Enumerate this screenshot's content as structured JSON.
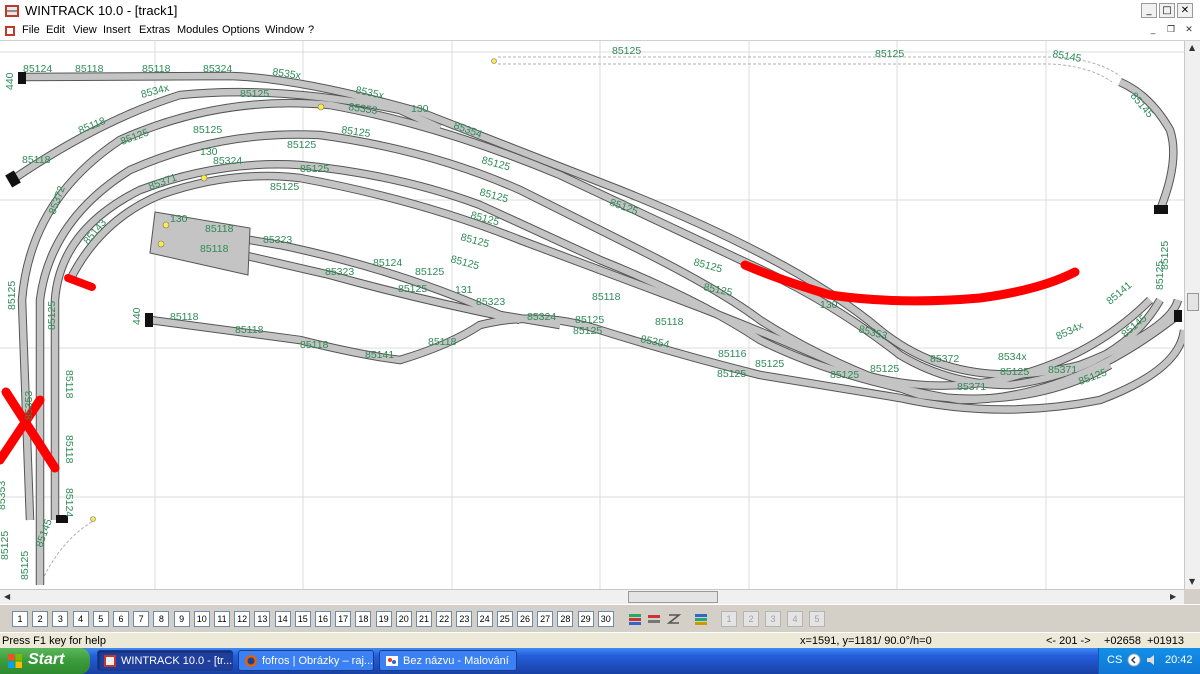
{
  "window": {
    "title": "WINTRACK 10.0 - [track1]"
  },
  "menu": [
    "File",
    "Edit",
    "View",
    "Insert",
    "Extras",
    "Modules",
    "Options",
    "Window",
    "?"
  ],
  "track_labels": [
    "85124",
    "85118",
    "85118",
    "85324",
    "8535x",
    "85125",
    "85145",
    "440",
    "8534x",
    "8535x",
    "85125",
    "85353",
    "130",
    "85354",
    "85145",
    "85118",
    "85125",
    "85125",
    "85125",
    "85125",
    "85118",
    "130",
    "85324",
    "85125",
    "85125",
    "85125",
    "85125",
    "85125",
    "85125",
    "85125",
    "85125",
    "85125",
    "85372",
    "85371",
    "85143",
    "85125",
    "85125",
    "440",
    "85118",
    "85118",
    "85118",
    "85141",
    "85118",
    "85323",
    "85323",
    "85124",
    "85125",
    "85125",
    "131",
    "85323",
    "85324",
    "85125",
    "85125",
    "85118",
    "85118",
    "85125",
    "85354",
    "85116",
    "85125",
    "85125",
    "85353",
    "85125",
    "85125",
    "85372",
    "8534x",
    "85371",
    "85371",
    "85141",
    "85145",
    "8534x",
    "85125",
    "85125",
    "85118",
    "85118",
    "85124",
    "85145",
    "85125",
    "85353",
    "85353",
    "85125",
    "130",
    "85125",
    "85125",
    "130",
    "85118",
    "85118",
    "85125"
  ],
  "layer_buttons": [
    "1",
    "2",
    "3",
    "4",
    "5",
    "6",
    "7",
    "8",
    "9",
    "10",
    "11",
    "12",
    "13",
    "14",
    "15",
    "16",
    "17",
    "18",
    "19",
    "20",
    "21",
    "22",
    "23",
    "24",
    "25",
    "26",
    "27",
    "28",
    "29",
    "30"
  ],
  "extra_buttons": [
    "1",
    "2",
    "3",
    "4",
    "5"
  ],
  "status": {
    "help": "Press F1 key for help",
    "coords": "x=1591, y=1181/ 90.0°/h=0",
    "page": "<- 201 ->",
    "pos_x": "+02658",
    "pos_y": "+01913"
  },
  "taskbar": {
    "start": "Start",
    "tasks": [
      "WINTRACK 10.0 - [tr...",
      "fofros | Obrázky – raj...",
      "Bez názvu - Malování"
    ],
    "lang": "CS",
    "time": "20:42"
  },
  "colors": {
    "label": "#2e8b57",
    "rail": "#c0c0c0",
    "markup": "#ff0000",
    "xp_blue": "#245edb",
    "start_green": "#3a9b3a"
  }
}
